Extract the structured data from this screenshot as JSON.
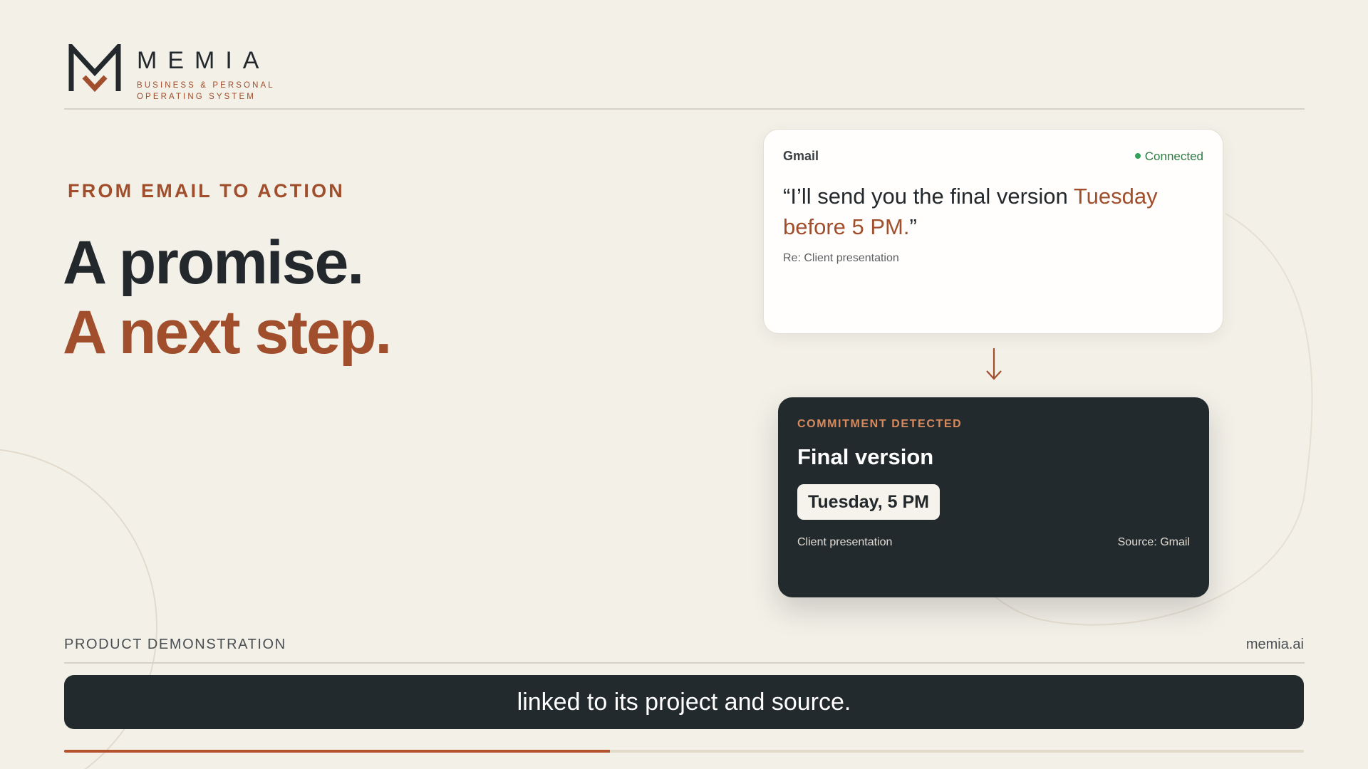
{
  "brand": {
    "name": "MEMIA",
    "tagline_line1": "Business & Personal",
    "tagline_line2": "Operating System",
    "colors": {
      "accent": "#a04e2b",
      "dark": "#22282c",
      "background": "#f3f0e8"
    }
  },
  "hero": {
    "eyebrow": "FROM EMAIL TO ACTION",
    "headline_line1": "A promise.",
    "headline_line2": "A next step."
  },
  "email_card": {
    "source": "Gmail",
    "status": "Connected",
    "status_color": "#2fa35a",
    "quote_open": "“",
    "quote_main": "I’ll send you the final version ",
    "quote_highlight": "Tuesday before 5 PM.",
    "quote_close": "”",
    "subject": "Re: Client presentation"
  },
  "flow_icon": "arrow-down-icon",
  "commitment_card": {
    "label": "COMMITMENT DETECTED",
    "title": "Final version",
    "due": "Tuesday, 5 PM",
    "project": "Client presentation",
    "source": "Source: Gmail"
  },
  "footer": {
    "label": "PRODUCT DEMONSTRATION",
    "url": "memia.ai",
    "caption": "linked to its project and source.",
    "progress": 0.44
  }
}
